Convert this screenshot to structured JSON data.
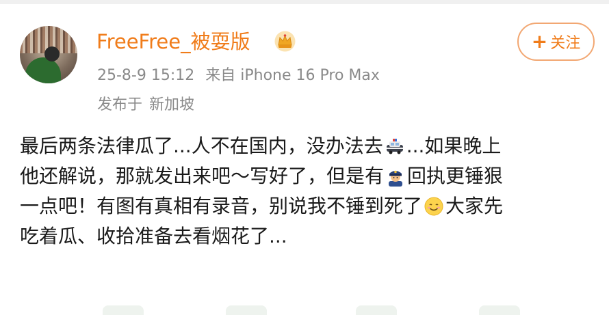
{
  "post_header": {
    "username": "FreeFree_被耍版",
    "badge_icon": "crown-icon",
    "timestamp": "25-8-9 15:12",
    "source": "来自 iPhone 16 Pro Max",
    "location_label": "发布于",
    "location": "新加坡",
    "follow_label": "关注",
    "follow_icon": "plus-icon"
  },
  "post": {
    "line1_a": "最后两条法律瓜了...人不在国内，没办法去",
    "line1_b": "...如果晚上",
    "line2_a": "他还解说，那就发出来吧～写好了，但是有",
    "line2_b": "回执更锤狠",
    "line3_a": "一点吧！有图有真相有录音，别说我不锤到死了",
    "line3_b": "大家先",
    "line4": "吃着瓜、收拾准备去看烟花了...",
    "emoji_1": "police-car-icon",
    "emoji_2": "police-officer-icon",
    "emoji_3": "smiling-face-icon"
  },
  "colors": {
    "accent": "#f07c1a",
    "meta_text": "#8a8a8a",
    "body_text": "#1a1a1a"
  }
}
